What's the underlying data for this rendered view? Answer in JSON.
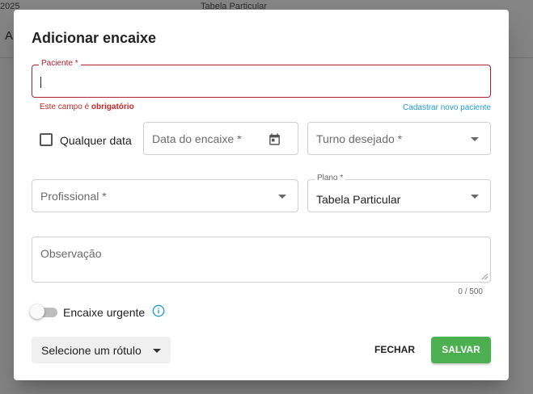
{
  "background": {
    "year_fragment": "2025",
    "table_label": "Tabela Particular",
    "heading_fragment": "Al"
  },
  "dialog": {
    "title": "Adicionar encaixe",
    "paciente": {
      "label": "Paciente *",
      "value": "",
      "error_prefix": "Este campo é ",
      "error_strong": "obrigatório",
      "new_link": "Cadastrar novo paciente"
    },
    "qualquer_data": {
      "label": "Qualquer data",
      "checked": false
    },
    "data_encaixe": {
      "placeholder": "Data do encaixe *",
      "icon": "calendar-icon"
    },
    "turno": {
      "placeholder": "Turno desejado *",
      "icon": "caret-down-icon"
    },
    "profissional": {
      "placeholder": "Profissional *",
      "icon": "caret-down-icon"
    },
    "plano": {
      "label": "Plano *",
      "value": "Tabela Particular",
      "icon": "caret-down-icon"
    },
    "observacao": {
      "placeholder": "Observação",
      "counter": "0 / 500"
    },
    "urgente": {
      "label": "Encaixe urgente",
      "on": false,
      "icon": "info-icon"
    },
    "rotulo": {
      "label": "Selecione um rótulo"
    },
    "actions": {
      "close": "FECHAR",
      "save": "SALVAR"
    },
    "colors": {
      "error": "#b0202d",
      "link": "#1e9bd0",
      "save": "#4caf50"
    }
  }
}
